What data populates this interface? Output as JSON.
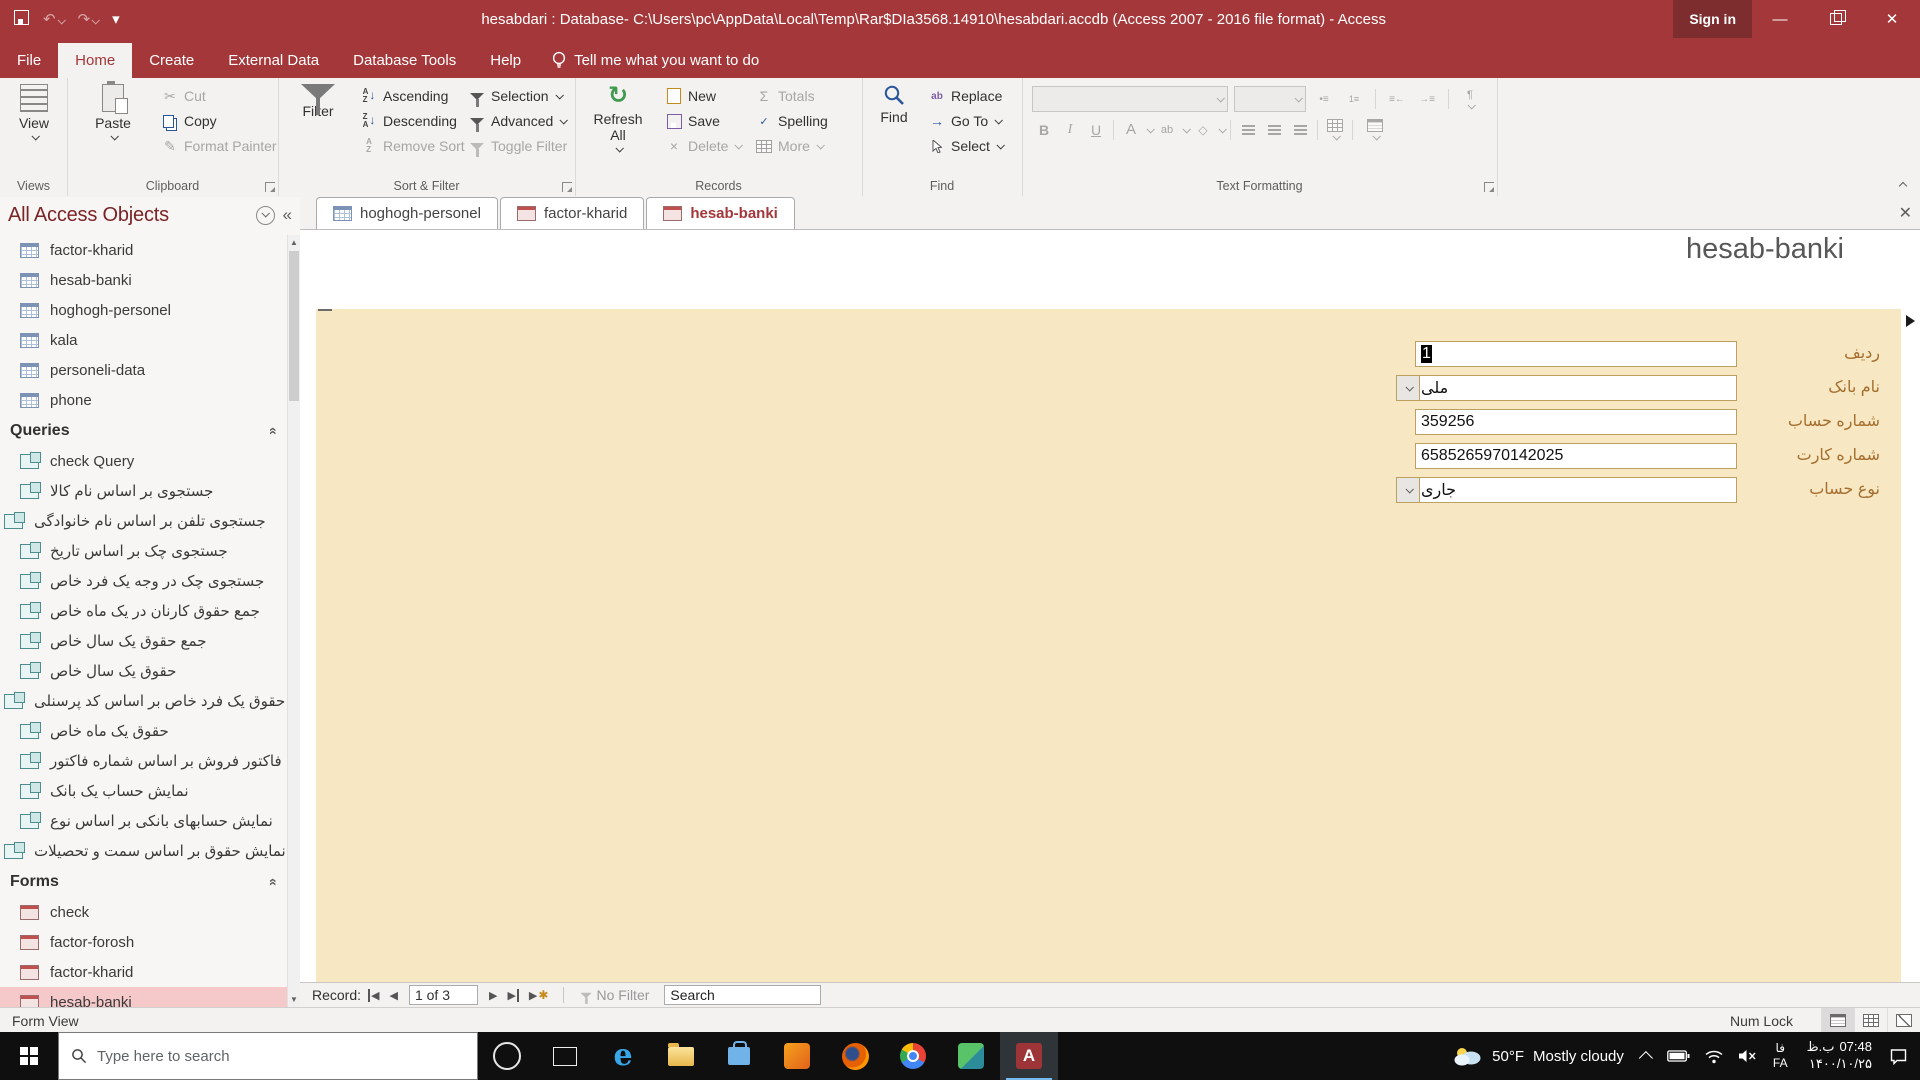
{
  "title_bar": {
    "title": "hesabdari : Database- C:\\Users\\pc\\AppData\\Local\\Temp\\Rar$DIa3568.14910\\hesabdari.accdb (Access 2007 - 2016 file format)  -  Access",
    "sign_in": "Sign in"
  },
  "menu": {
    "tabs": {
      "file": "File",
      "home": "Home",
      "create": "Create",
      "external_data": "External Data",
      "database_tools": "Database Tools",
      "help": "Help"
    },
    "tell_me": "Tell me what you want to do"
  },
  "ribbon": {
    "views": {
      "view": "View",
      "group_label": "Views"
    },
    "clipboard": {
      "paste": "Paste",
      "cut": "Cut",
      "copy": "Copy",
      "format_painter": "Format Painter",
      "group_label": "Clipboard"
    },
    "sort_filter": {
      "filter": "Filter",
      "ascending": "Ascending",
      "descending": "Descending",
      "remove_sort": "Remove Sort",
      "selection": "Selection",
      "advanced": "Advanced",
      "toggle_filter": "Toggle Filter",
      "group_label": "Sort & Filter"
    },
    "records": {
      "refresh_all": "Refresh All",
      "new": "New",
      "save": "Save",
      "delete": "Delete",
      "totals": "Totals",
      "spelling": "Spelling",
      "more": "More",
      "group_label": "Records"
    },
    "find": {
      "find": "Find",
      "replace": "Replace",
      "go_to": "Go To",
      "select": "Select",
      "group_label": "Find"
    },
    "text_formatting": {
      "bold": "B",
      "italic": "I",
      "underline": "U",
      "font_color": "A",
      "highlight": "ab",
      "group_label": "Text Formatting"
    }
  },
  "nav_pane": {
    "title": "All Access Objects",
    "tables": [
      {
        "label": "factor-kharid"
      },
      {
        "label": "hesab-banki"
      },
      {
        "label": "hoghogh-personel"
      },
      {
        "label": "kala"
      },
      {
        "label": "personeli-data"
      },
      {
        "label": "phone"
      }
    ],
    "queries_header": "Queries",
    "queries": [
      {
        "label": "check Query"
      },
      {
        "label": "جستجوی بر اساس نام کالا"
      },
      {
        "label": "جستجوی تلفن بر اساس نام خانوادگی",
        "mirrored": true
      },
      {
        "label": "جستجوی چک بر اساس تاریخ"
      },
      {
        "label": "جستجوی چک در وجه یک فرد خاص"
      },
      {
        "label": "جمع حقوق کارنان در یک ماه خاص"
      },
      {
        "label": "جمع حقوق یک سال خاص"
      },
      {
        "label": "حقوق یک سال خاص"
      },
      {
        "label": "حقوق یک فرد خاص بر اساس کد پرسنلی",
        "mirrored": true
      },
      {
        "label": "حقوق یک ماه خاص"
      },
      {
        "label": "فاکتور فروش بر اساس شماره فاکتور"
      },
      {
        "label": "نمایش حساب یک بانک"
      },
      {
        "label": "نمایش حسابهای بانکی بر اساس نوع"
      },
      {
        "label": "نمایش حقوق بر اساس سمت و تحصیلات",
        "mirrored": true
      }
    ],
    "forms_header": "Forms",
    "forms": [
      {
        "label": "check"
      },
      {
        "label": "factor-forosh"
      },
      {
        "label": "factor-kharid"
      },
      {
        "label": "hesab-banki",
        "selected": true
      }
    ]
  },
  "doc_tabs": {
    "tab1": "hoghogh-personel",
    "tab2": "factor-kharid",
    "tab3": "hesab-banki"
  },
  "form": {
    "title": "hesab-banki",
    "fields": {
      "radif": {
        "label": "ردیف",
        "value": "1"
      },
      "bank_name": {
        "label": "نام بانک",
        "value": "ملی"
      },
      "account_no": {
        "label": "شماره حساب",
        "value": "359256"
      },
      "card_no": {
        "label": "شماره کارت",
        "value": "6585265970142025"
      },
      "account_type": {
        "label": "نوع حساب",
        "value": "جاری"
      }
    }
  },
  "record_nav": {
    "record_label": "Record:",
    "position": "1 of 3",
    "no_filter": "No Filter",
    "search": "Search"
  },
  "status_bar": {
    "view_label": "Form View",
    "num_lock": "Num Lock"
  },
  "taskbar": {
    "search_placeholder": "Type here to search",
    "weather_temp": "50°F",
    "weather_text": "Mostly cloudy",
    "lang_fa": "فا",
    "lang_en": "FA",
    "time_suffix": "ب.ظ",
    "time": "07:48",
    "date": "۱۴۰۰/۱۰/۲۵"
  },
  "colors": {
    "accent_red": "#A4373A",
    "form_cream": "#F7E8C3",
    "selection_pink": "#F5C8CA",
    "label_brown": "#A56E2F"
  }
}
